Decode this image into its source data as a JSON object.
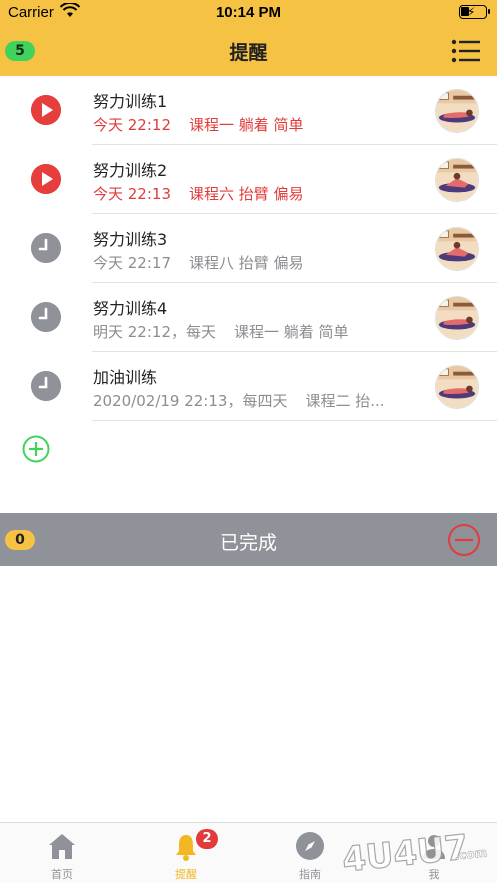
{
  "status_bar": {
    "carrier": "Carrier",
    "time": "10:14 PM"
  },
  "header": {
    "title": "提醒",
    "pending_count": "5"
  },
  "reminders": [
    {
      "title": "努力训练1",
      "time": "今天 22:12",
      "detail": "课程一 躺着 简单",
      "state": "active"
    },
    {
      "title": "努力训练2",
      "time": "今天 22:13",
      "detail": "课程六 抬臂 偏易",
      "state": "active"
    },
    {
      "title": "努力训练3",
      "time": "今天 22:17",
      "detail": "课程八 抬臂 偏易",
      "state": "scheduled"
    },
    {
      "title": "努力训练4",
      "time": "明天 22:12，每天",
      "detail": "课程一 躺着 简单",
      "state": "scheduled"
    },
    {
      "title": "加油训练",
      "time": "2020/02/19 22:13，每四天",
      "detail": "课程二 抬...",
      "state": "scheduled"
    }
  ],
  "completed": {
    "title": "已完成",
    "count": "0"
  },
  "tabbar": {
    "tabs": [
      {
        "label": "首页",
        "icon": "home-icon"
      },
      {
        "label": "提醒",
        "icon": "bell-icon",
        "badge": "2",
        "active": true
      },
      {
        "label": "指南",
        "icon": "compass-icon"
      },
      {
        "label": "我",
        "icon": "person-icon"
      }
    ]
  },
  "watermark": "4U4U7.com",
  "colors": {
    "header": "#f6c244",
    "active_red": "#e23b3b",
    "scheduled_gray": "#8f9399",
    "add_green": "#3fd35b"
  }
}
